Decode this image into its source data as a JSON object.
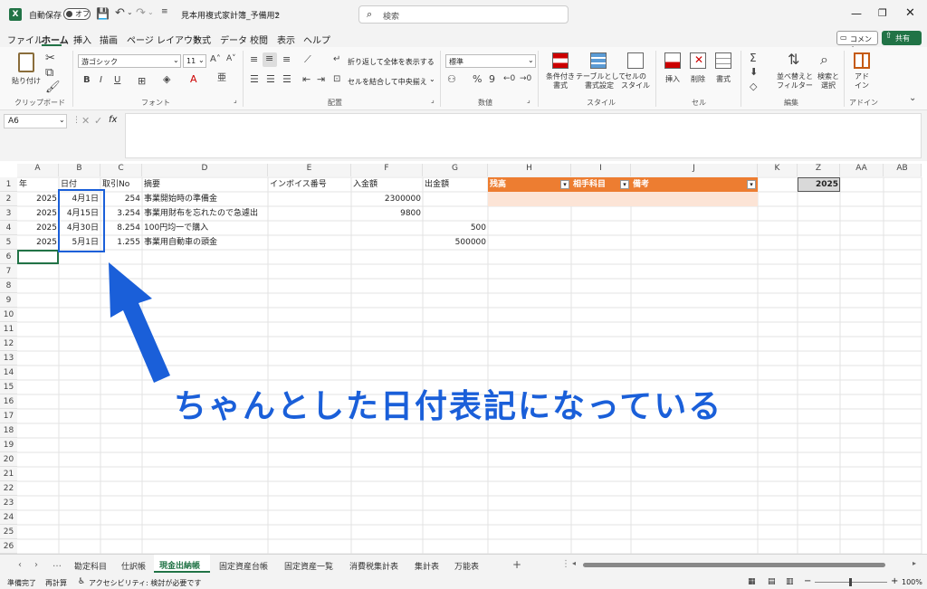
{
  "title_bar": {
    "autosave_label": "自動保存",
    "autosave_state": "オフ",
    "filename": "見本用複式家計簿_予備用2",
    "search_placeholder": "検索"
  },
  "menu": [
    "ファイル",
    "ホーム",
    "挿入",
    "描画",
    "ページ レイアウト",
    "数式",
    "データ",
    "校閲",
    "表示",
    "ヘルプ"
  ],
  "menu_active": "ホーム",
  "comment_label": "コメント",
  "share_label": "共有",
  "ribbon": {
    "paste_label": "貼り付け",
    "clipboard": "クリップボード",
    "font_name": "游ゴシック",
    "font_size": "11",
    "font": "フォント",
    "wrap_text": "折り返して全体を表示する",
    "merge_center": "セルを結合して中央揃え",
    "alignment": "配置",
    "number_format": "標準",
    "number": "数値",
    "cond_format": "条件付き\n書式",
    "table_format": "テーブルとして\n書式設定",
    "cell_style": "セルの\nスタイル",
    "style": "スタイル",
    "insert": "挿入",
    "delete": "削除",
    "format": "書式",
    "cells": "セル",
    "sort_filter": "並べ替えと\nフィルター",
    "find_select": "検索と\n選択",
    "editing": "編集",
    "addin": "アド\nイン",
    "addins": "アドイン"
  },
  "name_box": "A6",
  "formula_fx": "fx",
  "columns": [
    "A",
    "B",
    "C",
    "D",
    "E",
    "F",
    "G",
    "H",
    "I",
    "J",
    "K",
    "Z",
    "AA",
    "AB"
  ],
  "header_row": {
    "A": "年",
    "B": "日付",
    "C": "取引No",
    "D": "摘要",
    "E": "インボイス番号",
    "F": "入金額",
    "G": "出金額",
    "H": "残高",
    "I": "相手科目",
    "J": "備考",
    "Z": "2025"
  },
  "rows": [
    {
      "A": "2025",
      "B": "4月1日",
      "C": "254",
      "D": "事業開始時の準備金",
      "F": "2300000",
      "G": ""
    },
    {
      "A": "2025",
      "B": "4月15日",
      "C": "3.254",
      "D": "事業用財布を忘れたので急遽出",
      "F": "9800",
      "G": ""
    },
    {
      "A": "2025",
      "B": "4月30日",
      "C": "8.254",
      "D": "100円均一で購入",
      "F": "",
      "G": "500"
    },
    {
      "A": "2025",
      "B": "5月1日",
      "C": "1.255",
      "D": "事業用自動車の頭金",
      "F": "",
      "G": "500000"
    }
  ],
  "row_numbers": [
    "1",
    "2",
    "3",
    "4",
    "5",
    "6",
    "7",
    "8",
    "9",
    "10",
    "11",
    "12",
    "13",
    "14",
    "15",
    "16",
    "17",
    "18",
    "19",
    "20",
    "21",
    "22",
    "23",
    "24",
    "25",
    "26"
  ],
  "annotation_text": "ちゃんとした日付表記になっている",
  "sheet_tabs": [
    "勘定科目",
    "仕訳帳",
    "現金出納帳",
    "固定資産台帳",
    "固定資産一覧",
    "消費税集計表",
    "集計表",
    "万能表"
  ],
  "active_sheet": "現金出納帳",
  "status": {
    "ready": "準備完了",
    "recalc": "再計算",
    "accessibility": "アクセシビリティ: 検討が必要です",
    "zoom": "100%"
  },
  "colors": {
    "excel_green": "#217346",
    "header_orange": "#ED7D31",
    "light_orange": "#FCE4D6",
    "annotation_blue": "#1a5fd9"
  }
}
